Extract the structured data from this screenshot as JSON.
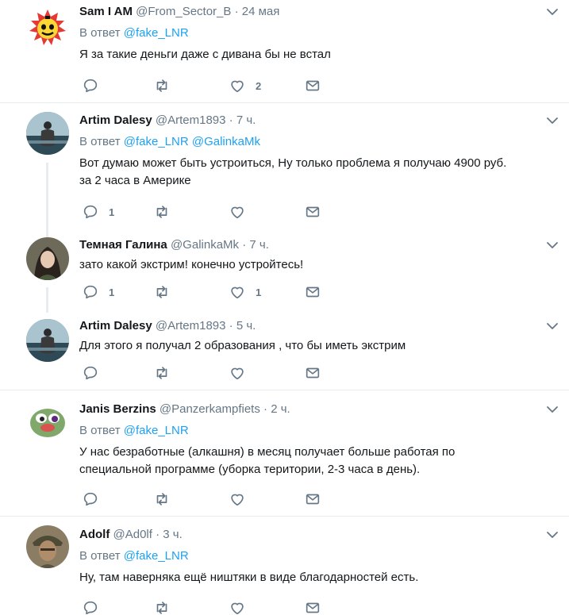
{
  "tweets": [
    {
      "name": "Sam I AM",
      "handle": "@From_Sector_B",
      "dot": "·",
      "time": "24 мая",
      "reply_prefix": "В ответ",
      "reply_to": [
        "@fake_LNR"
      ],
      "text": "Я за такие деньги даже с дивана бы не встал",
      "replies": "",
      "retweets": "",
      "likes": "2"
    },
    {
      "name": "Artim Dalesy",
      "handle": "@Artem1893",
      "dot": "·",
      "time": "7 ч.",
      "reply_prefix": "В ответ",
      "reply_to": [
        "@fake_LNR",
        "@GalinkaMk"
      ],
      "text_lines": [
        "Вот думаю может быть устроиться, Ну только проблема я получаю 4900 руб.",
        "за 2 часа в Америке"
      ],
      "replies": "1",
      "retweets": "",
      "likes": ""
    },
    {
      "name": "Темная Галина",
      "handle": "@GalinkaMk",
      "dot": "·",
      "time": "7 ч.",
      "text": "зато какой экстрим! конечно устройтесь!",
      "replies": "1",
      "retweets": "",
      "likes": "1"
    },
    {
      "name": "Artim Dalesy",
      "handle": "@Artem1893",
      "dot": "·",
      "time": "5 ч.",
      "text": "Для этого я получал 2 образования , что бы иметь экстрим",
      "replies": "",
      "retweets": "",
      "likes": ""
    },
    {
      "name": "Janis Berzins",
      "handle": "@Panzerkampfiets",
      "dot": "·",
      "time": "2 ч.",
      "reply_prefix": "В ответ",
      "reply_to": [
        "@fake_LNR"
      ],
      "text_lines": [
        "У нас безработные (алкашня) в месяц получает больше работая по",
        "специальной программе (уборка територии, 2-3 часа в день)."
      ],
      "replies": "",
      "retweets": "",
      "likes": ""
    },
    {
      "name": "Adolf",
      "handle": "@Ad0lf",
      "dot": "·",
      "time": "3 ч.",
      "reply_prefix": "В ответ",
      "reply_to": [
        "@fake_LNR"
      ],
      "text": "Ну, там наверняка ещё ништяки в виде благодарностей есть.",
      "replies": "",
      "retweets": "",
      "likes": ""
    }
  ],
  "icons": {
    "reply": "reply-icon",
    "retweet": "retweet-icon",
    "like": "heart-icon",
    "dm": "envelope-icon",
    "more": "chevron-down-icon"
  },
  "colors": {
    "text": "#14171a",
    "secondary": "#657786",
    "link": "#1da1f2",
    "divider": "#e6ecf0"
  }
}
